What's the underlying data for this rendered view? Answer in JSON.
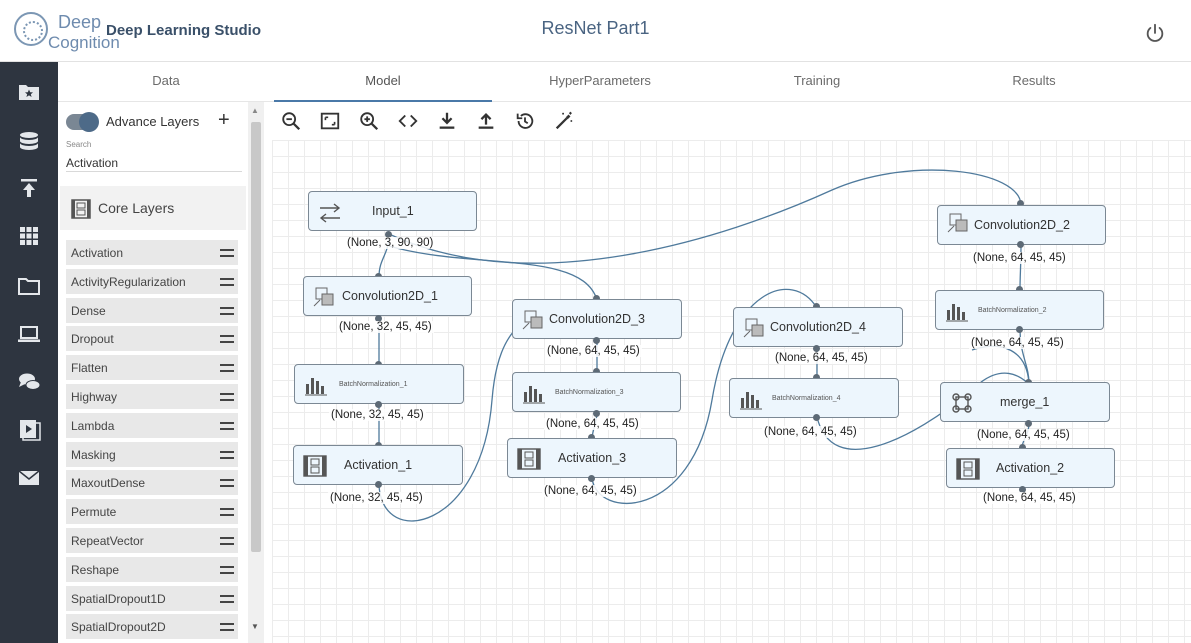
{
  "header": {
    "logo_line1": "Deep",
    "logo_line2": "Cognition",
    "app_title": "Deep Learning Studio",
    "project_title": "ResNet Part1",
    "power_icon": "power-icon"
  },
  "rail": {
    "icons": [
      "folder-star-icon",
      "database-icon",
      "upload-icon",
      "grid-icon",
      "folder-icon",
      "laptop-icon",
      "chat-icon",
      "video-icon",
      "mail-icon"
    ]
  },
  "tabs": [
    {
      "label": "Data",
      "active": false
    },
    {
      "label": "Model",
      "active": true
    },
    {
      "label": "HyperParameters",
      "active": false
    },
    {
      "label": "Training",
      "active": false
    },
    {
      "label": "Results",
      "active": false
    }
  ],
  "panel": {
    "toggle_label": "Advance Layers",
    "add_icon": "+",
    "search_label": "Search",
    "search_value": "Activation",
    "category_label": "Core Layers",
    "layers": [
      "Activation",
      "ActivityRegularization",
      "Dense",
      "Dropout",
      "Flatten",
      "Highway",
      "Lambda",
      "Masking",
      "MaxoutDense",
      "Permute",
      "RepeatVector",
      "Reshape",
      "SpatialDropout1D",
      "SpatialDropout2D"
    ]
  },
  "toolbar": {
    "tools": [
      "zoom-out-icon",
      "fit-screen-icon",
      "zoom-in-icon",
      "code-icon",
      "download-icon",
      "upload-icon",
      "history-icon",
      "magic-wand-icon"
    ]
  },
  "graph": {
    "nodes": {
      "input_1": {
        "label": "Input_1",
        "shape": "(None, 3, 90, 90)"
      },
      "conv2d_1": {
        "label": "Convolution2D_1",
        "shape": "(None, 32, 45, 45)"
      },
      "bn_1": {
        "label": "BatchNormalization_1",
        "shape": "(None, 32, 45, 45)"
      },
      "act_1": {
        "label": "Activation_1",
        "shape": "(None, 32, 45, 45)"
      },
      "conv2d_3": {
        "label": "Convolution2D_3",
        "shape": "(None, 64, 45, 45)"
      },
      "bn_3": {
        "label": "BatchNormalization_3",
        "shape": "(None, 64, 45, 45)"
      },
      "act_3": {
        "label": "Activation_3",
        "shape": "(None, 64, 45, 45)"
      },
      "conv2d_4": {
        "label": "Convolution2D_4",
        "shape": "(None, 64, 45, 45)"
      },
      "bn_4": {
        "label": "BatchNormalization_4",
        "shape": "(None, 64, 45, 45)"
      },
      "conv2d_2": {
        "label": "Convolution2D_2",
        "shape": "(None, 64, 45, 45)"
      },
      "bn_2": {
        "label": "BatchNormalization_2",
        "shape": "(None, 64, 45, 45)"
      },
      "merge_1": {
        "label": "merge_1",
        "shape": "(None, 64, 45, 45)"
      },
      "act_2": {
        "label": "Activation_2",
        "shape": "(None, 64, 45, 45)"
      }
    }
  },
  "colors": {
    "rail_bg": "#2e3540",
    "node_fill": "#edf6fd",
    "accent": "#4a79a8",
    "wire": "#4f7a9c"
  }
}
